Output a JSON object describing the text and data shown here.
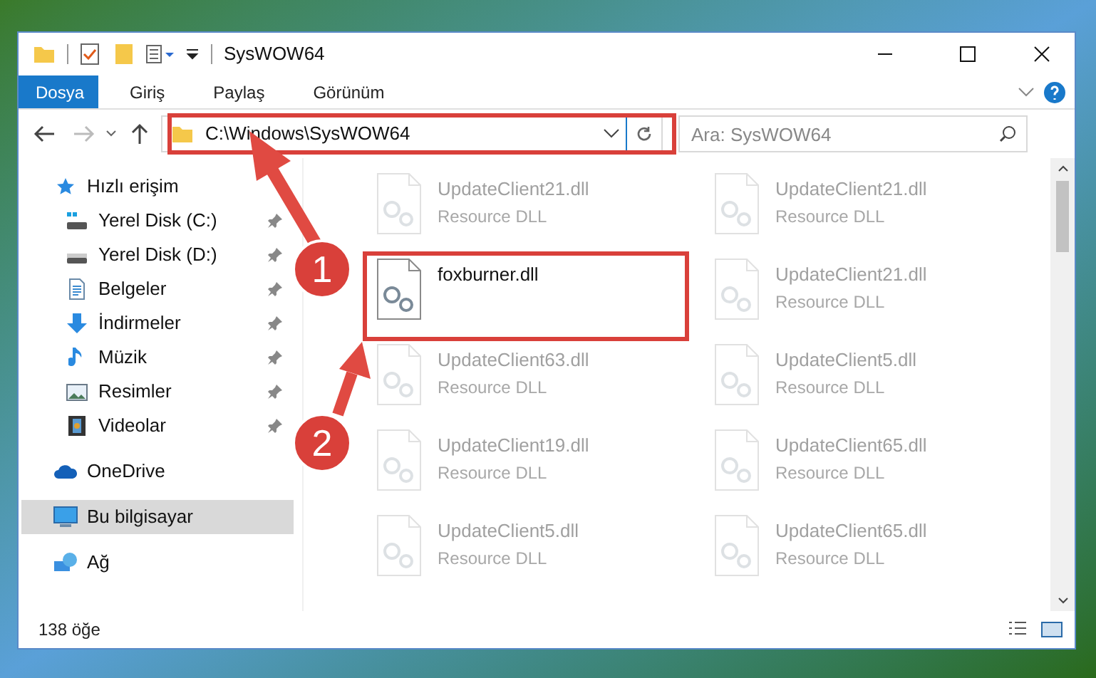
{
  "window": {
    "title": "SysWOW64"
  },
  "ribbon": {
    "tabs": [
      {
        "label": "Dosya",
        "selected": true
      },
      {
        "label": "Giriş",
        "selected": false
      },
      {
        "label": "Paylaş",
        "selected": false
      },
      {
        "label": "Görünüm",
        "selected": false
      }
    ]
  },
  "address_bar": {
    "path": "C:\\Windows\\SysWOW64"
  },
  "search": {
    "placeholder": "Ara: SysWOW64"
  },
  "sidebar": {
    "items": [
      {
        "label": "Hızlı erişim",
        "kind": "star",
        "selected": false,
        "children": [
          {
            "label": "Yerel Disk (C:)",
            "kind": "drive-windows",
            "pinned": true,
            "selected": false
          },
          {
            "label": "Yerel Disk (D:)",
            "kind": "drive",
            "pinned": true,
            "selected": false
          },
          {
            "label": "Belgeler",
            "kind": "documents",
            "pinned": true,
            "selected": false
          },
          {
            "label": "İndirmeler",
            "kind": "downloads",
            "pinned": true,
            "selected": false
          },
          {
            "label": "Müzik",
            "kind": "music",
            "pinned": true,
            "selected": false
          },
          {
            "label": "Resimler",
            "kind": "pictures",
            "pinned": true,
            "selected": false
          },
          {
            "label": "Videolar",
            "kind": "videos",
            "pinned": true,
            "selected": false
          }
        ]
      },
      {
        "label": "OneDrive",
        "kind": "cloud",
        "selected": false
      },
      {
        "label": "Bu bilgisayar",
        "kind": "computer",
        "selected": true
      },
      {
        "label": "Ağ",
        "kind": "network",
        "selected": false
      }
    ]
  },
  "files": [
    {
      "name": "UpdateClient21.dll",
      "type": "Resource DLL",
      "dimmed": true
    },
    {
      "name": "UpdateClient21.dll",
      "type": "Resource DLL",
      "dimmed": true
    },
    {
      "name": "foxburner.dll",
      "dimmed": false
    },
    {
      "name": "UpdateClient21.dll",
      "type": "Resource DLL",
      "dimmed": true
    },
    {
      "name": "UpdateClient63.dll",
      "type": "Resource DLL",
      "dimmed": true
    },
    {
      "name": "UpdateClient5.dll",
      "type": "Resource DLL",
      "dimmed": true
    },
    {
      "name": "UpdateClient19.dll",
      "type": "Resource DLL",
      "dimmed": true
    },
    {
      "name": "UpdateClient65.dll",
      "type": "Resource DLL",
      "dimmed": true
    },
    {
      "name": "UpdateClient5.dll",
      "type": "Resource DLL",
      "dimmed": true
    },
    {
      "name": "UpdateClient65.dll",
      "type": "Resource DLL",
      "dimmed": true
    }
  ],
  "status_bar": {
    "item_count": "138 öğe"
  },
  "annotations": [
    {
      "number": "1"
    },
    {
      "number": "2"
    }
  ]
}
